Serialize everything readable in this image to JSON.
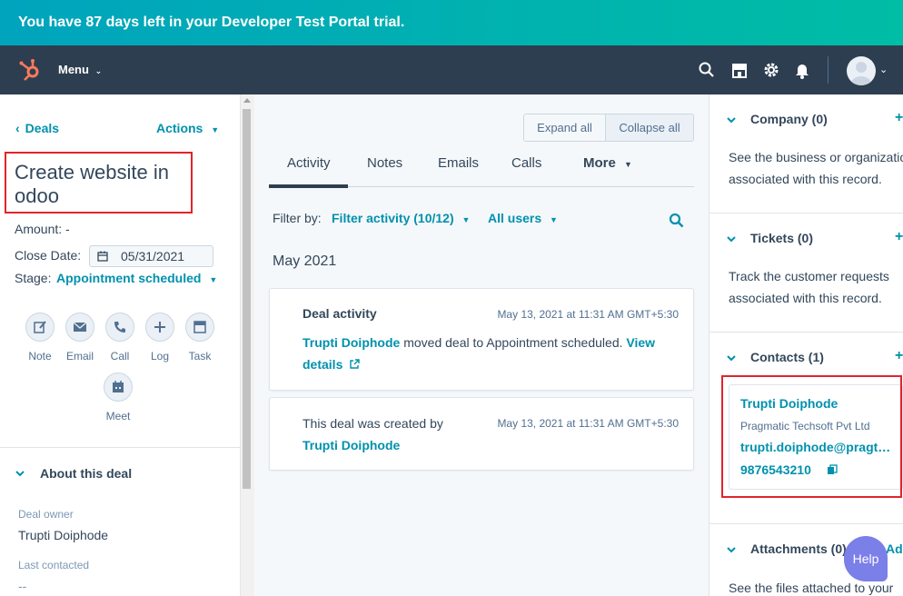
{
  "banner": {
    "text": "You have 87 days left in your Developer Test Portal trial."
  },
  "nav": {
    "menu_label": "Menu"
  },
  "left": {
    "back_label": "Deals",
    "actions_label": "Actions",
    "title": "Create website in odoo",
    "amount": "Amount: -",
    "close_date_label": "Close Date:",
    "close_date_value": "05/31/2021",
    "stage_label": "Stage:",
    "stage_value": "Appointment scheduled",
    "quick_actions": [
      {
        "label": "Note",
        "icon": "note-icon"
      },
      {
        "label": "Email",
        "icon": "email-icon"
      },
      {
        "label": "Call",
        "icon": "call-icon"
      },
      {
        "label": "Log",
        "icon": "log-icon"
      },
      {
        "label": "Task",
        "icon": "task-icon"
      },
      {
        "label": "Meet",
        "icon": "meet-icon"
      }
    ],
    "about_title": "About this deal",
    "deal_owner_label": "Deal owner",
    "deal_owner_value": "Trupti Doiphode",
    "last_contacted_label": "Last contacted",
    "last_contacted_value": "--"
  },
  "middle": {
    "expand_all": "Expand all",
    "collapse_all": "Collapse all",
    "tabs": [
      "Activity",
      "Notes",
      "Emails",
      "Calls",
      "More"
    ],
    "filter_by": "Filter by:",
    "filter_activity": "Filter activity (10/12)",
    "all_users": "All users",
    "month": "May 2021",
    "cards": [
      {
        "heading": "Deal activity",
        "timestamp": "May 13, 2021 at 11:31 AM GMT+5:30",
        "actor": "Trupti Doiphode",
        "text": " moved deal to Appointment scheduled. ",
        "link": "View details"
      },
      {
        "text": "This deal was created by",
        "timestamp": "May 13, 2021 at 11:31 AM GMT+5:30",
        "actor": "Trupti Doiphode"
      }
    ]
  },
  "right": {
    "company_title": "Company (0)",
    "company_desc_1": "See the business or organization",
    "company_desc_2": "associated with this record.",
    "tickets_title": "Tickets (0)",
    "tickets_desc_1": "Track the customer requests",
    "tickets_desc_2": "associated with this record.",
    "contacts_title": "Contacts (1)",
    "contact": {
      "name": "Trupti Doiphode",
      "company": "Pragmatic Techsoft Pvt Ltd",
      "email": "trupti.doiphode@pragtech.co.in",
      "phone": "9876543210"
    },
    "attachments_title": "Attachments (0)",
    "attachments_add": "Add",
    "attachments_desc": "See the files attached to your"
  },
  "help_label": "Help",
  "plus": "+"
}
